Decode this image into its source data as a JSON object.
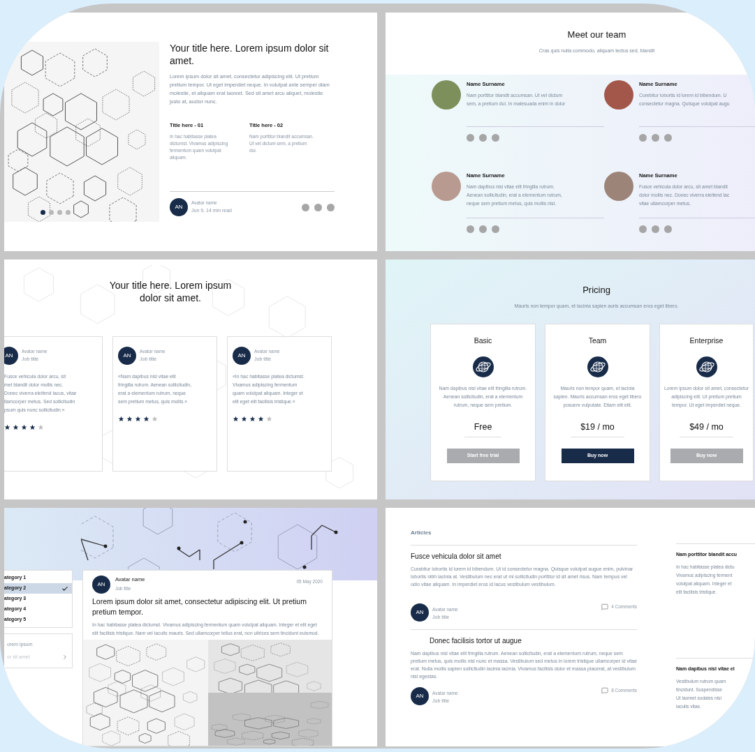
{
  "hero_article": {
    "title": "Your title here. Lorem ipsum dolor sit amet.",
    "body": "Lorem ipsum dolor sit amet, consectetur adipiscing elit. Ut pretium pretium tempor. Ut eget imperdiet neque. In volutpat ante semper diam molestie, et aliquam erat laoreet. Sed sit amet arcu aliquet, molestie justo at, auctor nunc.",
    "features": [
      {
        "title": "Title here - 01",
        "text": "In hac habitasse platea dictumst. Vivamus adipiscing fermentum quam volutpat aliquam."
      },
      {
        "title": "Title here - 02",
        "text": "Nam porttitor blandit accumsan. Ut vel dictum sem, a pretium dui."
      }
    ],
    "author": {
      "initials": "AN",
      "name": "Avatar name",
      "meta": "Jun 9, 14 min read"
    },
    "carousel_dots": [
      {
        "selected": true
      },
      {
        "selected": false
      },
      {
        "selected": false
      },
      {
        "selected": false
      }
    ]
  },
  "team": {
    "title": "Meet our team",
    "subtitle": "Cras quis nulla commodo, aliquam lectus sed, blandit",
    "members": [
      {
        "name": "Name Surname",
        "bio": "Nam porttitor blandit accumsan. Ut vel dictum\nsem, a pretium dui. In malesuada enim in dolor"
      },
      {
        "name": "Name Surname",
        "bio": "Curebitur lobortis id lorem id bibendum. U\nconsectetur magna. Quisque volutpat augu"
      },
      {
        "name": "Name Surname",
        "bio": "Nam dapibus nisl vitae elit fringilla rutrum.\nAenean sollicitudin, erat a elementum rutrum,\nneque sem pretium metus, quis mollis nisl."
      },
      {
        "name": "Name Surname",
        "bio": "Fusce vehicula dolor arcu, sit amet blandit\ndolor mollis nec. Donec viverra eleifend lac\nvitae ullamcorper metus."
      }
    ]
  },
  "testimonials": {
    "title": "Your title here. Lorem ipsum dolor sit amet.",
    "cards": [
      {
        "initials": "AN",
        "name": "Avatar name",
        "job": "Job title",
        "quote": "Fusce vehicula dolor arcu, sit\nmet blandit dolor mollis nec.\nDonec viverra eleifend lacus, vitae\nllamcorper metus. Sed sollicitudin\npsum quis nunc sollicitudin.»",
        "stars": 4
      },
      {
        "initials": "AN",
        "name": "Avatar name",
        "job": "Job title",
        "quote": "«Nam dapibus nisl vitae elit\nfringilla rutrum. Aenean sollicitudin,\nerat a elementum rutrum, neque\nsem pretium metus, quis mollis.»",
        "stars": 4
      },
      {
        "initials": "AN",
        "name": "Avatar name",
        "job": "Job title",
        "quote": "«In hac habitasse platea dictumst.\nVivamus adipiscing fermentum\nquam volutpat aliquam. Integer et\nelit eget elit facilisis tristique.»",
        "stars": 4
      }
    ]
  },
  "pricing": {
    "title": "Pricing",
    "subtitle": "Mauris non tempor quam, et lacinia sapien auris accumsan eros eget libero.",
    "plans": [
      {
        "name": "Basic",
        "description": "Nam dapibus nisl vitae elit fringilla rutrum. Aenean sollicitudin, erat a elementum rutrum, neque sem pretium.",
        "price": "Free",
        "button": "Start free trial",
        "primary": false
      },
      {
        "name": "Team",
        "description": "Mauris non tempor quam, et lacinia sapien. Mauris accumsan eros eget libero posuere vulputate. Etiam elit elit.",
        "price": "$19 / mo",
        "button": "Buy now",
        "primary": true
      },
      {
        "name": "Enterprise",
        "description": "Lorem ipsum dolor sit amet, consectetur adipiscing elit. Ut pretium pretium tempor. Ut eget imperdiet neque.",
        "price": "$49 / mo",
        "button": "Buy now",
        "primary": false
      }
    ]
  },
  "blog": {
    "categories": [
      {
        "label": "ategory 1",
        "selected": false
      },
      {
        "label": "ategory 2",
        "selected": true
      },
      {
        "label": "ategory 3",
        "selected": false
      },
      {
        "label": "ategory 4",
        "selected": false
      },
      {
        "label": "ategory 5",
        "selected": false
      }
    ],
    "menu": [
      "orem ipsum",
      "or sit amet"
    ],
    "post": {
      "initials": "AN",
      "name": "Avatar name",
      "job": "Job title",
      "date": "05 May 2020",
      "title": "Lorem ipsum dolor sit amet, consectetur adipiscing elit. Ut pretium pretium tempor.",
      "body": "In hac habitasse platea dictumst. Vivamus adipiscing fermentum quam volutpat aliquam. Integer et elit eget elit facilisis tristique. Nam vel iaculis mauris. Sed ullamcorper tellus erat, non ultrices sem tincidunt euismod."
    }
  },
  "articles": {
    "heading": "Articles",
    "items": [
      {
        "title": "Fusce vehicula dolor sit amet",
        "body": "Curabitur lobortis id lorem id bibendum. Ut id consectetur magna. Quisque volutpat augue enim, pulvinar lobortis nibh lacinia at. Vestibulum nec erat ut mi sollicitudin porttitor id sit amet risus. Nam tempus vel odio vitae aliquam. In imperdiet eros id lacus vestibulum vestibulum.",
        "initials": "AN",
        "name": "Avatar name",
        "job": "Job title",
        "comments": "4 Comments"
      },
      {
        "title": "Donec facilisis tortor ut augue",
        "body": "Nam dapibus nisl vitae elit fringilla rutrum. Aenean sollicitudin, erat a elementum rutrum, neque sem pretium metus, quis mollis nisl nunc et massa. Vestibulum sed metus in lorem tristique ullamcorper id vitae erat. Nulla mollis sapien sollicitudin lacinia lacinia. Vivamus facilisis dolor et massa placerat, at vestibulum nisl egestas.",
        "initials": "AN",
        "name": "Avatar name",
        "job": "Job title",
        "comments": "8 Comments"
      }
    ],
    "sidebar": [
      {
        "title": "Nam porttitor blandit accu",
        "body": "In hac habitasse platea dictu\nVivamus adipiscing ferment\nvolutpat aliquam. Integer et\nelit facilisis tristique."
      },
      {
        "title": "Nam dapibus nisl vitae el",
        "body": "Vestibulum rutrum quam\ntincidunt. Suspendisse\nUt laoreet sodales nisi\niaculis vitae."
      }
    ]
  }
}
